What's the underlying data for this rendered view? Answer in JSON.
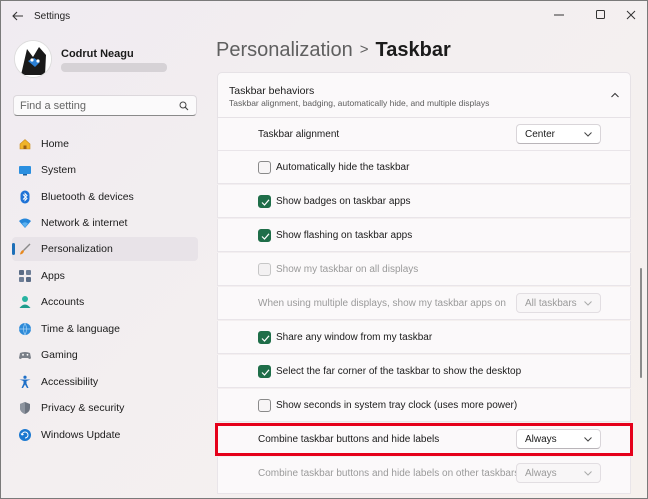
{
  "window": {
    "title": "Settings",
    "controls": [
      "minimize-icon",
      "maximize-icon",
      "close-icon"
    ]
  },
  "profile": {
    "name": "Codrut Neagu"
  },
  "search": {
    "placeholder": "Find a setting"
  },
  "nav": {
    "items": [
      {
        "label": "Home",
        "icon": "home-icon"
      },
      {
        "label": "System",
        "icon": "system-icon"
      },
      {
        "label": "Bluetooth & devices",
        "icon": "bluetooth-icon"
      },
      {
        "label": "Network & internet",
        "icon": "wifi-icon"
      },
      {
        "label": "Personalization",
        "icon": "brush-icon",
        "selected": true
      },
      {
        "label": "Apps",
        "icon": "apps-icon"
      },
      {
        "label": "Accounts",
        "icon": "person-icon"
      },
      {
        "label": "Time & language",
        "icon": "globe-clock-icon"
      },
      {
        "label": "Gaming",
        "icon": "gamepad-icon"
      },
      {
        "label": "Accessibility",
        "icon": "accessibility-icon"
      },
      {
        "label": "Privacy & security",
        "icon": "shield-icon"
      },
      {
        "label": "Windows Update",
        "icon": "update-icon"
      }
    ]
  },
  "breadcrumb": {
    "parent": "Personalization",
    "separator": ">",
    "current": "Taskbar"
  },
  "section": {
    "title": "Taskbar behaviors",
    "subtitle": "Taskbar alignment, badging, automatically hide, and multiple displays",
    "expanded": true,
    "settings": [
      {
        "type": "dropdown",
        "label": "Taskbar alignment",
        "value": "Center",
        "enabled": true
      },
      {
        "type": "checkbox",
        "label": "Automatically hide the taskbar",
        "checked": false,
        "enabled": true
      },
      {
        "type": "checkbox",
        "label": "Show badges on taskbar apps",
        "checked": true,
        "enabled": true
      },
      {
        "type": "checkbox",
        "label": "Show flashing on taskbar apps",
        "checked": true,
        "enabled": true
      },
      {
        "type": "checkbox",
        "label": "Show my taskbar on all displays",
        "checked": false,
        "enabled": false
      },
      {
        "type": "dropdown",
        "label": "When using multiple displays, show my taskbar apps on",
        "value": "All taskbars",
        "enabled": false
      },
      {
        "type": "checkbox",
        "label": "Share any window from my taskbar",
        "checked": true,
        "enabled": true
      },
      {
        "type": "checkbox",
        "label": "Select the far corner of the taskbar to show the desktop",
        "checked": true,
        "enabled": true
      },
      {
        "type": "checkbox",
        "label": "Show seconds in system tray clock (uses more power)",
        "checked": false,
        "enabled": true
      },
      {
        "type": "dropdown",
        "label": "Combine taskbar buttons and hide labels",
        "value": "Always",
        "enabled": true,
        "highlighted": true
      },
      {
        "type": "dropdown",
        "label": "Combine taskbar buttons and hide labels on other taskbars",
        "value": "Always",
        "enabled": false
      }
    ]
  },
  "colors": {
    "accent": "#1d6fb8",
    "checkbox_checked": "#1f6e49",
    "highlight": "#e5001a"
  }
}
